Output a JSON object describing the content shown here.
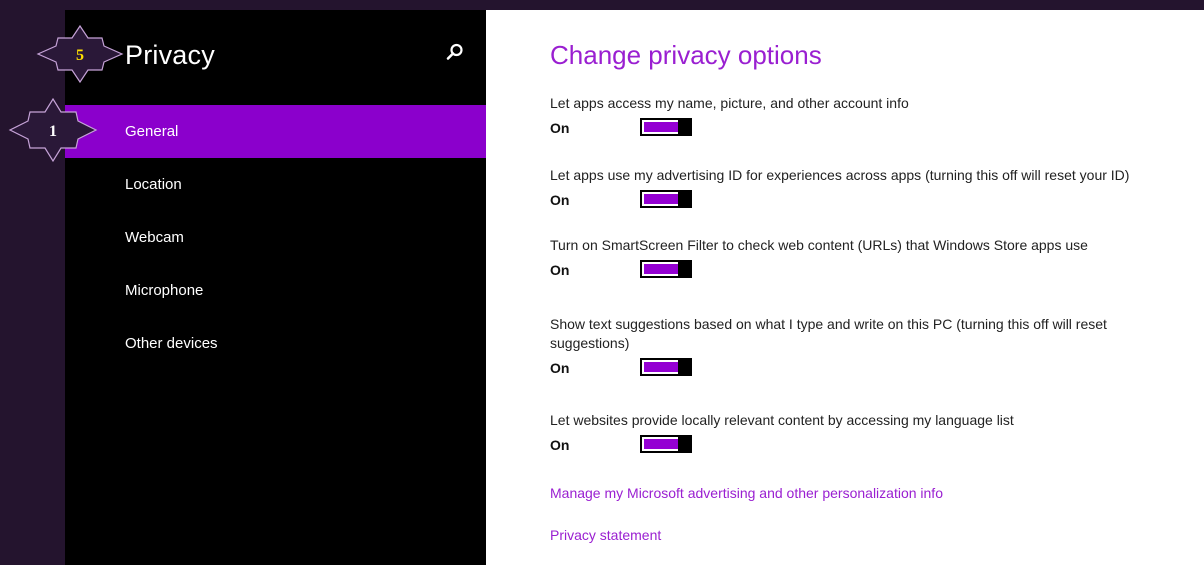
{
  "sidebar": {
    "title": "Privacy",
    "search_icon": "search-icon",
    "items": [
      {
        "label": "General",
        "selected": true
      },
      {
        "label": "Location",
        "selected": false
      },
      {
        "label": "Webcam",
        "selected": false
      },
      {
        "label": "Microphone",
        "selected": false
      },
      {
        "label": "Other devices",
        "selected": false
      }
    ]
  },
  "badges": {
    "title_badge": "5",
    "general_badge": "1"
  },
  "main": {
    "title": "Change privacy options",
    "settings": [
      {
        "description": "Let apps access my name, picture, and other account info",
        "state": "On"
      },
      {
        "description": "Let apps use my advertising ID for experiences across apps (turning this off will reset your ID)",
        "state": "On"
      },
      {
        "description": "Turn on SmartScreen Filter to check web content (URLs) that Windows Store apps use",
        "state": "On"
      },
      {
        "description": "Show text suggestions based on what I type and write on this PC (turning this off will reset suggestions)",
        "state": "On"
      },
      {
        "description": "Let websites provide locally relevant content by accessing my language list",
        "state": "On"
      }
    ],
    "links": [
      "Manage my Microsoft advertising and other personalization info",
      "Privacy statement"
    ]
  },
  "colors": {
    "accent": "#9400d3",
    "selected_bg": "#8b00cc",
    "title_color": "#9a1fd1",
    "badge_text": "#ffe000",
    "frame": "#24142e"
  }
}
